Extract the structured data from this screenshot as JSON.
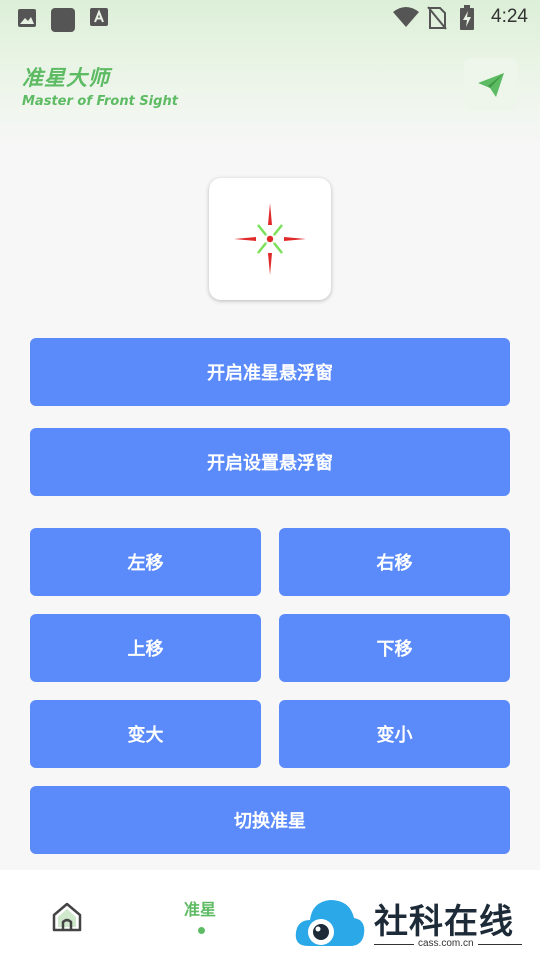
{
  "status_bar": {
    "time": "4:24",
    "icons": [
      "image-icon",
      "app-square-icon",
      "font-icon",
      "wifi-icon",
      "no-sim-icon",
      "battery-charging-icon"
    ]
  },
  "header": {
    "title": "准星大师",
    "subtitle": "Master of Front Sight",
    "share_icon": "paper-plane-icon"
  },
  "crosshair": {
    "colors": {
      "arms": "#e02a2a",
      "diagonals": "#7be05a",
      "center": "#e02a2a"
    }
  },
  "buttons": {
    "open_crosshair_window": "开启准星悬浮窗",
    "open_settings_window": "开启设置悬浮窗",
    "move_left": "左移",
    "move_right": "右移",
    "move_up": "上移",
    "move_down": "下移",
    "enlarge": "变大",
    "shrink": "变小",
    "switch_crosshair": "切换准星"
  },
  "bottom_nav": {
    "home_icon": "home-icon",
    "active_tab": "准星"
  },
  "watermark": {
    "text": "社科在线",
    "domain": "cass.com.cn"
  },
  "colors": {
    "accent_green": "#5dbb63",
    "button_blue": "#5b8bfa"
  }
}
